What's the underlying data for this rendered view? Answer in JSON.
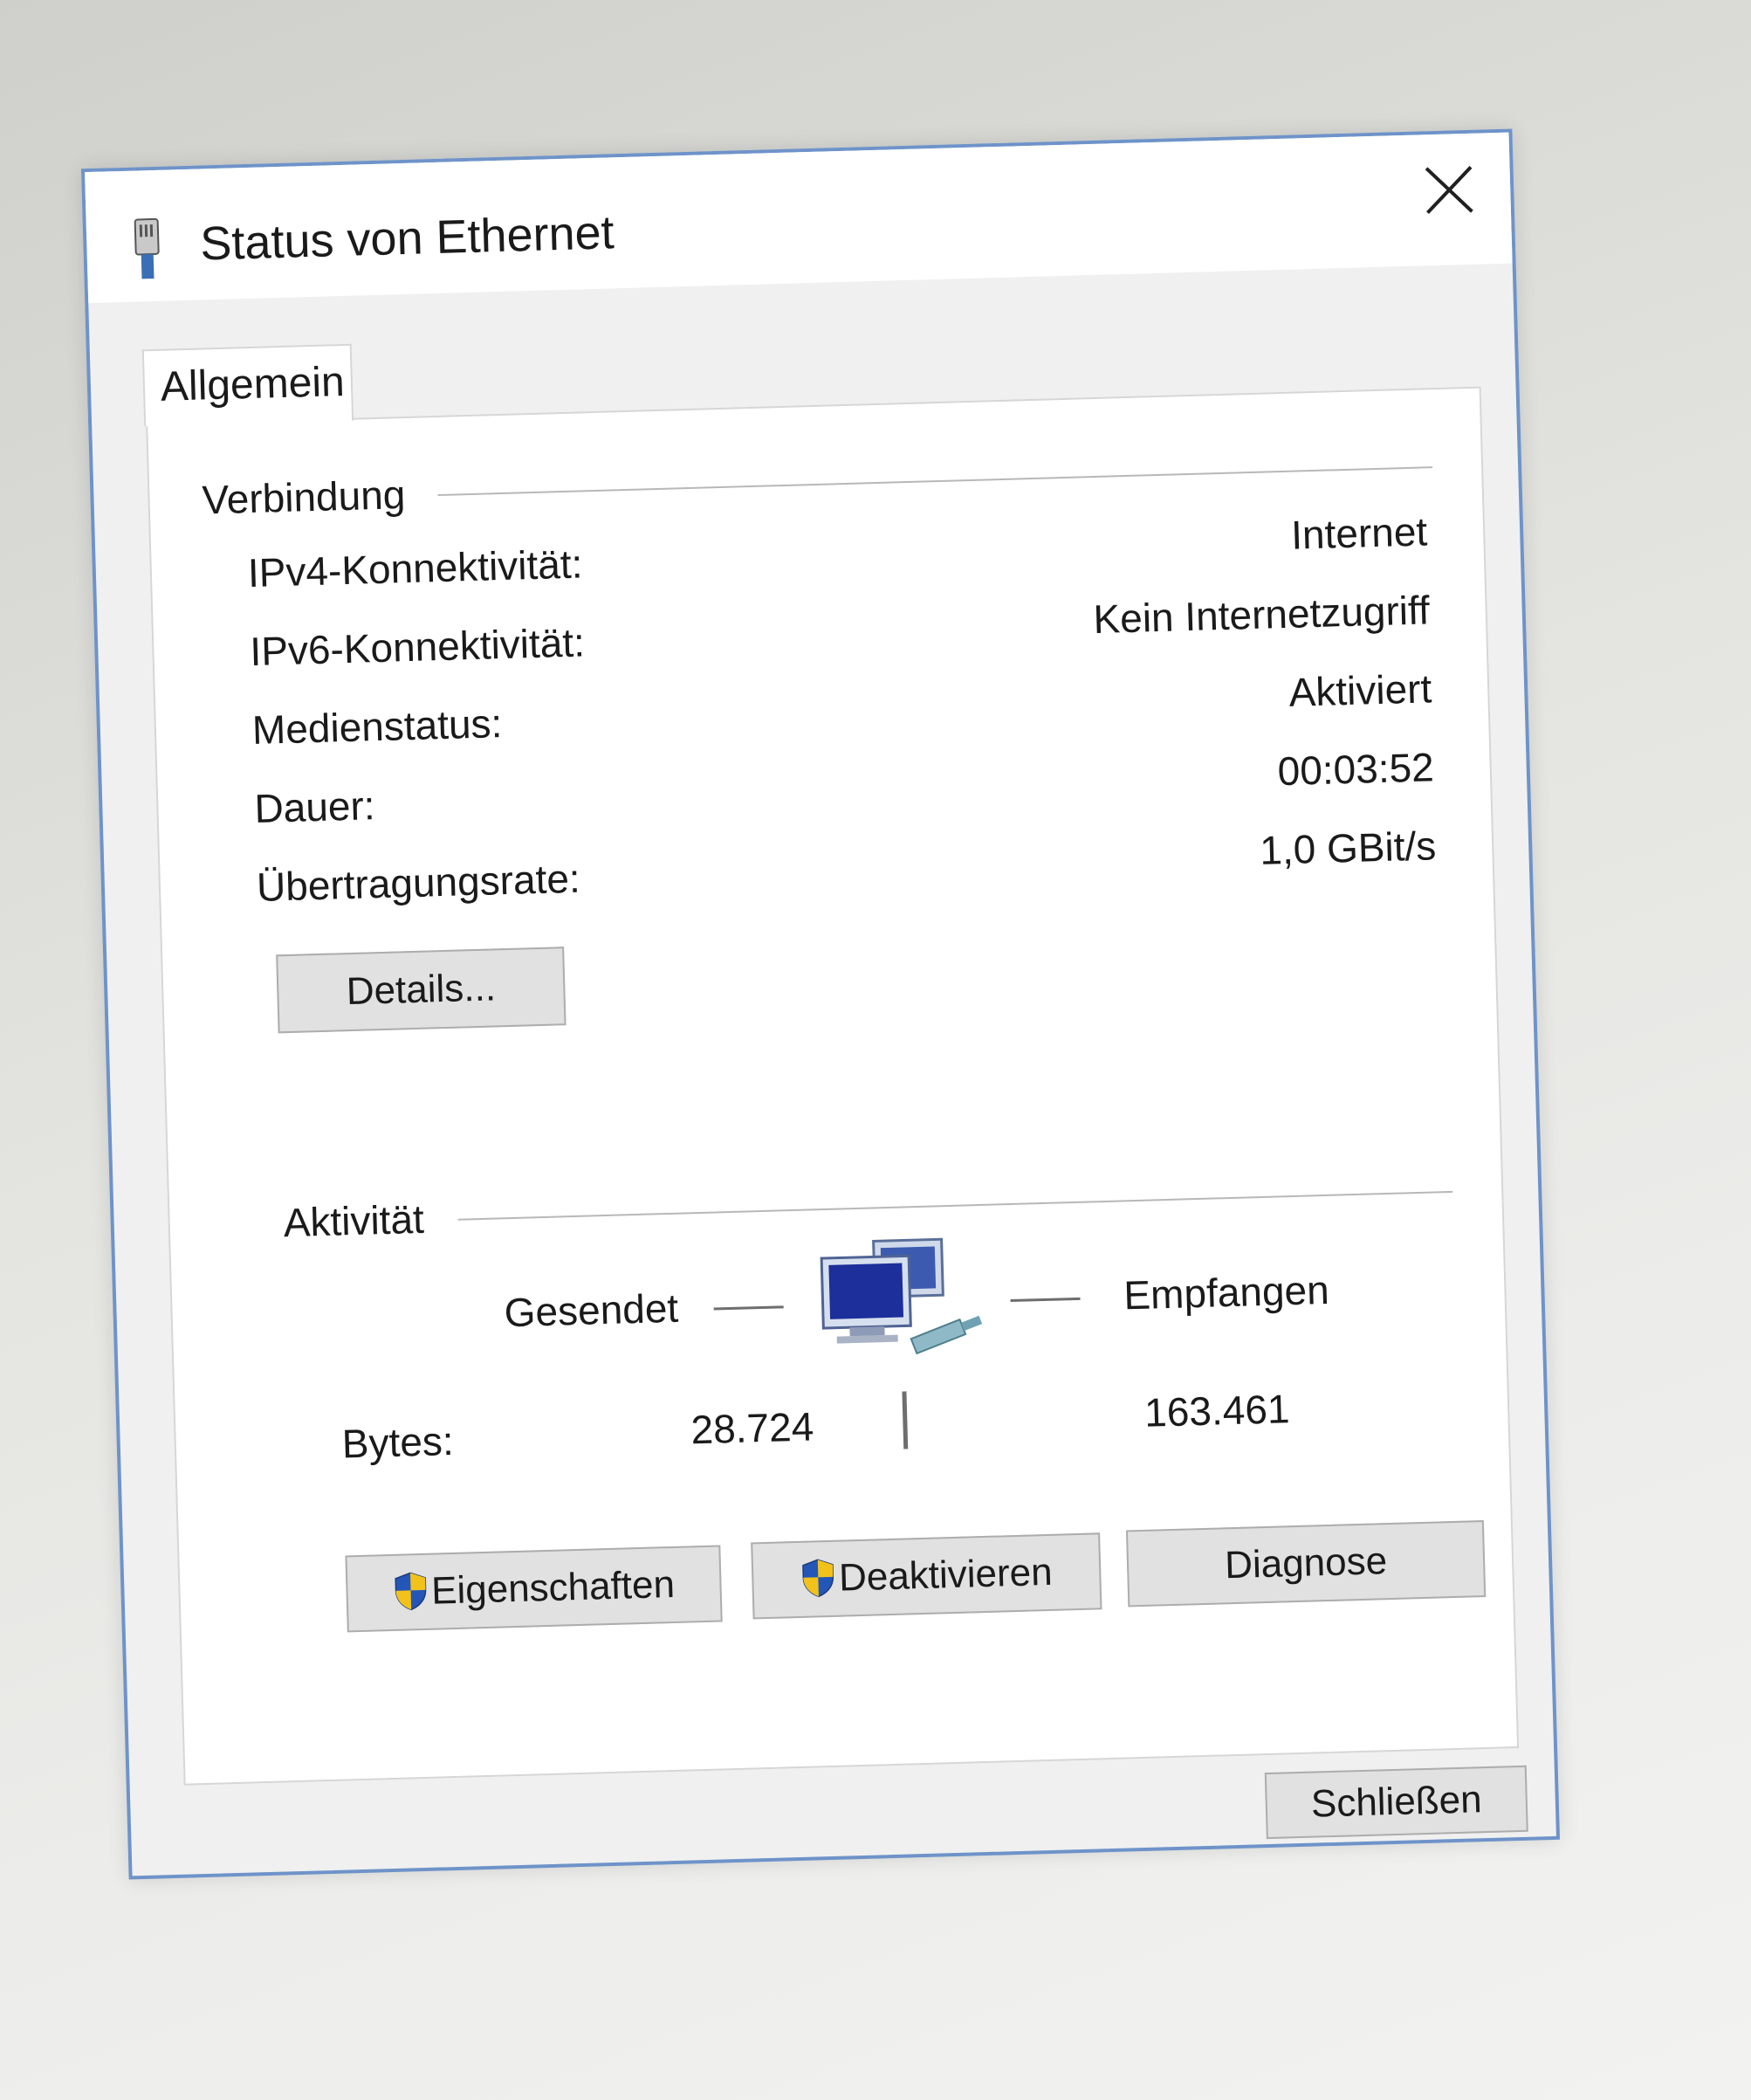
{
  "window": {
    "title": "Status von Ethernet"
  },
  "tabs": [
    {
      "label": "Allgemein"
    }
  ],
  "connection": {
    "heading": "Verbindung",
    "rows": [
      {
        "label": "IPv4-Konnektivität:",
        "value": "Internet"
      },
      {
        "label": "IPv6-Konnektivität:",
        "value": "Kein Internetzugriff"
      },
      {
        "label": "Medienstatus:",
        "value": "Aktiviert"
      },
      {
        "label": "Dauer:",
        "value": "00:03:52"
      },
      {
        "label": "Übertragungsrate:",
        "value": "1,0 GBit/s"
      }
    ],
    "details_button": "Details..."
  },
  "activity": {
    "heading": "Aktivität",
    "sent_label": "Gesendet",
    "received_label": "Empfangen",
    "bytes_label": "Bytes:",
    "bytes_sent": "28.724",
    "bytes_received": "163.461"
  },
  "buttons": {
    "properties": "Eigenschaften",
    "disable": "Deaktivieren",
    "diagnose": "Diagnose",
    "close": "Schließen"
  },
  "icons": {
    "title": "ethernet-plug-icon",
    "activity": "network-computers-icon",
    "shield": "uac-shield-icon"
  },
  "colors": {
    "window_border": "#6e93c9",
    "shield_blue": "#2456b8",
    "shield_yellow": "#f2c21b"
  }
}
